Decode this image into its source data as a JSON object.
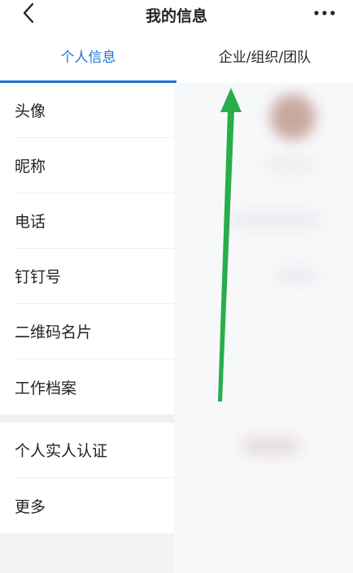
{
  "navbar": {
    "title": "我的信息",
    "back_icon": "chevron-left-icon",
    "more_icon": "more-horizontal-icon"
  },
  "tabs": [
    {
      "label": "个人信息",
      "active": true
    },
    {
      "label": "企业/组织/团队",
      "active": false
    }
  ],
  "personal_items_group1": [
    {
      "label": "头像"
    },
    {
      "label": "昵称"
    },
    {
      "label": "电话"
    },
    {
      "label": "钉钉号"
    },
    {
      "label": "二维码名片"
    },
    {
      "label": "工作档案"
    }
  ],
  "personal_items_group2": [
    {
      "label": "个人实人认证"
    },
    {
      "label": "更多"
    }
  ],
  "colors": {
    "accent": "#1677d9",
    "annotation_arrow": "#27ae4a"
  }
}
